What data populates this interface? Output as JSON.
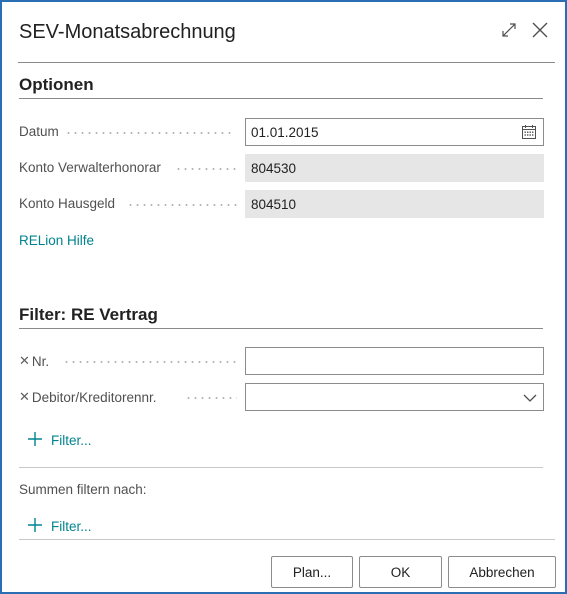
{
  "dialog": {
    "title": "SEV-Monatsabrechnung"
  },
  "options": {
    "heading": "Optionen",
    "datum": {
      "label": "Datum",
      "value": "01.01.2015"
    },
    "konto_verwalter": {
      "label": "Konto Verwalterhonorar",
      "value": "804530"
    },
    "konto_hausgeld": {
      "label": "Konto Hausgeld",
      "value": "804510"
    },
    "help_link": "RELion Hilfe"
  },
  "filter_vertrag": {
    "heading": "Filter: RE Vertrag",
    "nr": {
      "label": "Nr.",
      "value": ""
    },
    "debitor": {
      "label": "Debitor/Kreditorennr.",
      "value": ""
    },
    "add_filter": "Filter..."
  },
  "summen": {
    "label": "Summen filtern nach:",
    "add_filter": "Filter..."
  },
  "buttons": {
    "plan": "Plan...",
    "ok": "OK",
    "cancel": "Abbrechen"
  },
  "icons": {
    "expand": "expand-icon",
    "close": "close-icon",
    "calendar": "calendar-icon",
    "chevron": "chevron-down-icon",
    "plus": "plus-icon",
    "clear": "clear-filter-icon"
  },
  "colors": {
    "accent_link": "#00838f",
    "dialog_border": "#2a6fb4",
    "readonly_bg": "#e6e6e6"
  }
}
